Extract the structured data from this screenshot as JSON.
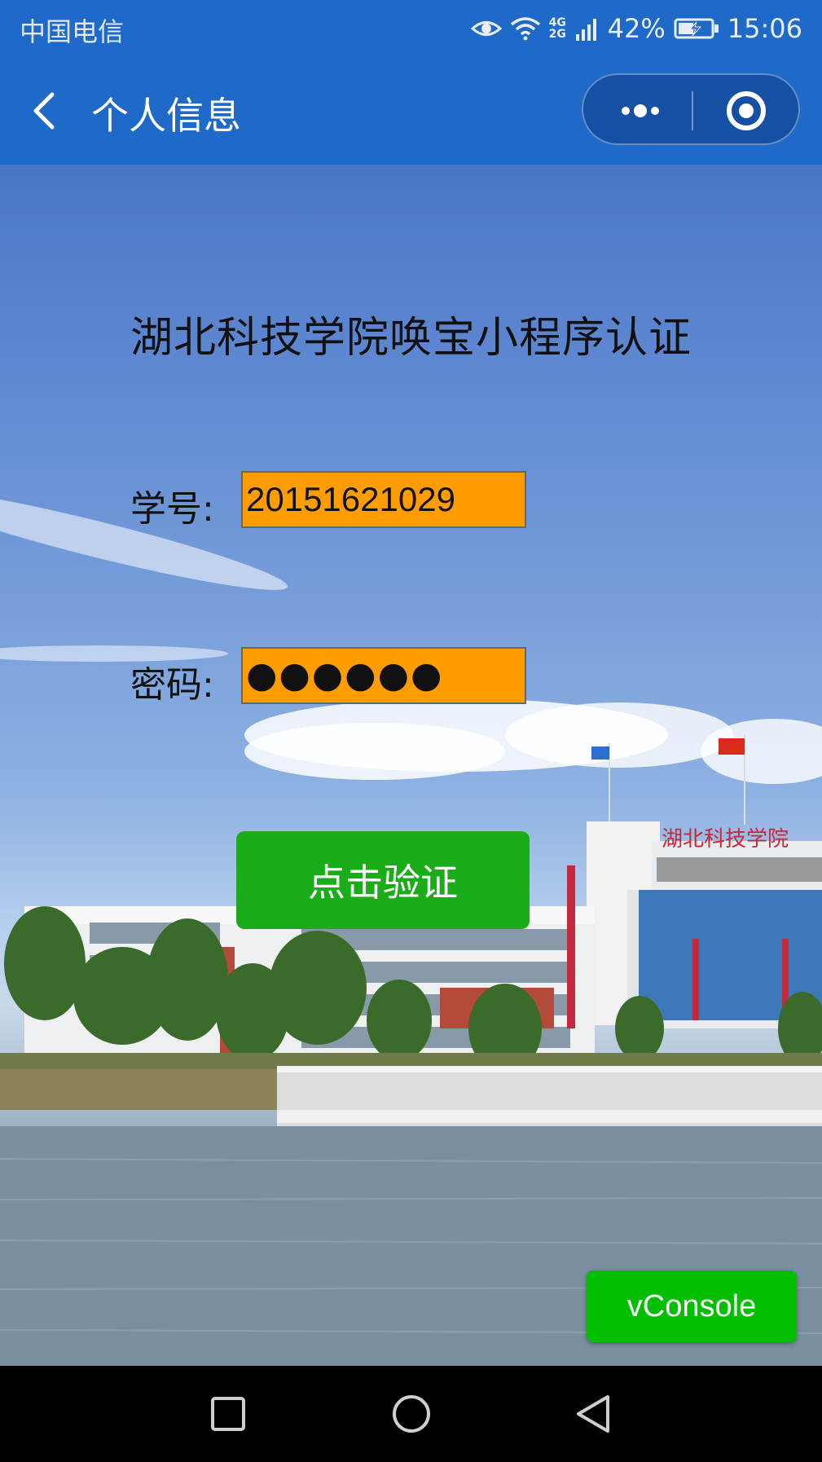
{
  "status_bar": {
    "carrier": "中国电信",
    "network": "4G 2G",
    "battery": "42%",
    "time": "15:06"
  },
  "nav": {
    "title": "个人信息"
  },
  "page": {
    "heading": "湖北科技学院唤宝小程序认证",
    "student_id_label": "学号:",
    "student_id_value": "20151621029",
    "password_label": "密码:",
    "password_value": "●●●●●●",
    "verify_label": "点击验证",
    "building_sign": "湖北科技学院"
  },
  "debug": {
    "vconsole_label": "vConsole"
  },
  "colors": {
    "nav_blue": "#1f69c9",
    "field_orange": "#ff9d00",
    "verify_green": "#1aad19",
    "vconsole_green": "#04be02"
  }
}
